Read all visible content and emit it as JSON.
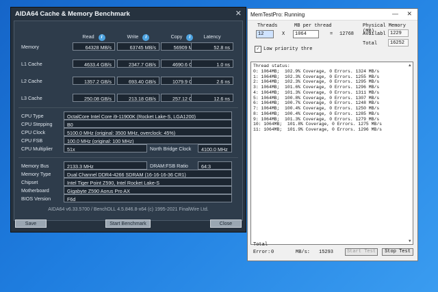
{
  "aida": {
    "title": "AIDA64 Cache & Memory Benchmark",
    "columns": {
      "read": "Read",
      "write": "Write",
      "copy": "Copy",
      "latency": "Latency"
    },
    "bench": [
      {
        "label": "Memory",
        "read": "64328 MB/s",
        "write": "63745 MB/s",
        "copy": "56909 MB/s",
        "latency": "52.8 ns"
      },
      {
        "label": "L1 Cache",
        "read": "4633.4 GB/s",
        "write": "2347.7 GB/s",
        "copy": "4690.6 GB/s",
        "latency": "1.0 ns"
      },
      {
        "label": "L2 Cache",
        "read": "1357.2 GB/s",
        "write": "693.40 GB/s",
        "copy": "1079.9 GB/s",
        "latency": "2.6 ns"
      },
      {
        "label": "L3 Cache",
        "read": "250.08 GB/s",
        "write": "213.18 GB/s",
        "copy": "257.12 GB/s",
        "latency": "12.6 ns"
      }
    ],
    "cpu": {
      "type_label": "CPU Type",
      "type": "OctalCore Intel Core i9-11900K  (Rocket Lake-S, LGA1200)",
      "stepping_label": "CPU Stepping",
      "stepping": "B0",
      "clock_label": "CPU Clock",
      "clock": "5100.0 MHz  (original: 3500 MHz, overclock: 45%)",
      "fsb_label": "CPU FSB",
      "fsb": "100.0 MHz  (original: 100 MHz)",
      "mult_label": "CPU Multiplier",
      "mult": "51x",
      "nb_label": "North Bridge Clock",
      "nb": "4100.0 MHz"
    },
    "mem": {
      "bus_label": "Memory Bus",
      "bus": "2133.3 MHz",
      "ratio_label": "DRAM:FSB Ratio",
      "ratio": "64:3",
      "type_label": "Memory Type",
      "type": "Dual Channel DDR4-4266 SDRAM  (16-16-16-36 CR1)",
      "chipset_label": "Chipset",
      "chipset": "Intel Tiger Point Z590, Intel Rocket Lake-S",
      "mobo_label": "Motherboard",
      "mobo": "Gigabyte Z590 Aorus Pro AX",
      "bios_label": "BIOS Version",
      "bios": "F6d"
    },
    "footer": "AIDA64 v6.33.5700 / BenchDLL 4.5.846.8-x64  (c) 1995-2021 FinalWire Ltd.",
    "buttons": {
      "save": "Save",
      "start": "Start Benchmark",
      "close": "Close"
    }
  },
  "mtp": {
    "title": "MemTestPro: Running",
    "threads_label": "Threads",
    "threads_value": "12",
    "x_label": "X",
    "mb_label": "MB per thread",
    "mb_value": "1064",
    "eq_label": "=",
    "total_mb": "12768",
    "phys_label": "Physical Memory (MB)",
    "avail_label": "Availabl",
    "avail_value": "1229",
    "total_label": "Total",
    "total_value": "16252",
    "low_priority": "Low priority thre",
    "status_lines": [
      "Thread status:",
      "0: 1064MB;  102.9% Coverage, 0 Errors. 1324 MB/s",
      "1: 1064MB;  102.3% Coverage, 0 Errors. 1255 MB/s",
      "2: 1064MB;  102.3% Coverage, 0 Errors. 1295 MB/s",
      "3: 1064MB;  101.6% Coverage, 0 Errors. 1296 MB/s",
      "4: 1064MB;  101.3% Coverage, 0 Errors. 1311 MB/s",
      "5: 1064MB;  100.8% Coverage, 0 Errors. 1307 MB/s",
      "6: 1064MB;  100.7% Coverage, 0 Errors. 1248 MB/s",
      "7: 1064MB;  100.4% Coverage, 0 Errors. 1250 MB/s",
      "8: 1064MB;  100.4% Coverage, 0 Errors. 1285 MB/s",
      "9: 1064MB;  101.3% Coverage, 0 Errors. 1279 MB/s",
      "10: 1064MB;  101.8% Coverage, 0 Errors. 1275 MB/s",
      "11: 1064MB;  101.9% Coverage, 0 Errors. 1296 MB/s"
    ],
    "total_section_label": "Total",
    "error_label": "Error:",
    "error_value": "0",
    "mbs_label": "MB/s:",
    "mbs_value": "15293",
    "start_test": "Start Test",
    "stop_test": "Stop Test"
  }
}
